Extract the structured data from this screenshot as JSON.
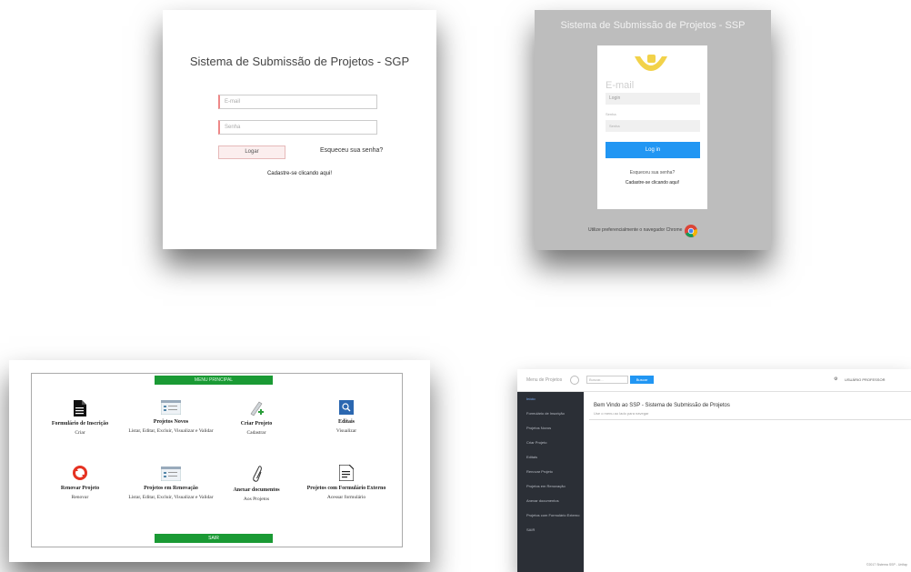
{
  "login1": {
    "title": "Sistema de Submissão de Projetos - SGP",
    "email_placeholder": "E-mail",
    "password_placeholder": "Senha",
    "login_label": "Logar",
    "forgot_label": "Esqueceu sua senha?",
    "register_label": "Cadastre-se clicando aqui!"
  },
  "login2": {
    "title": "Sistema de Submissão de Projetos - SSP",
    "email_label": "E-mail",
    "login_placeholder": "Login",
    "password_label": "Senha",
    "password_placeholder": "Senha",
    "login_button": "Log in",
    "forgot_label": "Esqueceu sua senha?",
    "register_label": "Cadastre-se clicando aqui!",
    "footer": "Utilize preferencialmente o navegador Chrome"
  },
  "menu": {
    "header": "MENU PRINCIPAL",
    "exit": "SAIR",
    "tiles": [
      {
        "title": "Formulário de Inscrição",
        "sub": "Criar"
      },
      {
        "title": "Projetos Novos",
        "sub": "Listar, Editar, Excluir, Visualizar e Validar"
      },
      {
        "title": "Criar Projeto",
        "sub": "Cadastrar"
      },
      {
        "title": "Editais",
        "sub": "Visualizar"
      },
      {
        "title": "Renovar Projeto",
        "sub": "Renovar"
      },
      {
        "title": "Projetos em Renovação",
        "sub": "Listar, Editar, Excluir, Visualizar e Validar"
      },
      {
        "title": "Anexar documentos",
        "sub": "Aos Projetos"
      },
      {
        "title": "Projetos com Formulário Externo",
        "sub": "Acessar formulário"
      }
    ]
  },
  "dashboard": {
    "brand": "Menu de Projetos",
    "search_placeholder": "Buscar...",
    "search_button": "Buscar",
    "user": "USUÁRIO PROFESSOR",
    "sidebar": [
      "Início",
      "Formulário de Inscrição",
      "Projetos Novos",
      "Criar Projeto",
      "Editais",
      "Renovar Projeto",
      "Projetos em Renovação",
      "Anexar documentos",
      "Projetos com Formulário Externo",
      "SAIR"
    ],
    "welcome": "Bem Vindo ao SSP - Sistema de Submissão de Projetos",
    "welcome_sub": "Use o menu ao lado para navegar",
    "copyright": "©2017 Sistema SSP - Unifap"
  }
}
